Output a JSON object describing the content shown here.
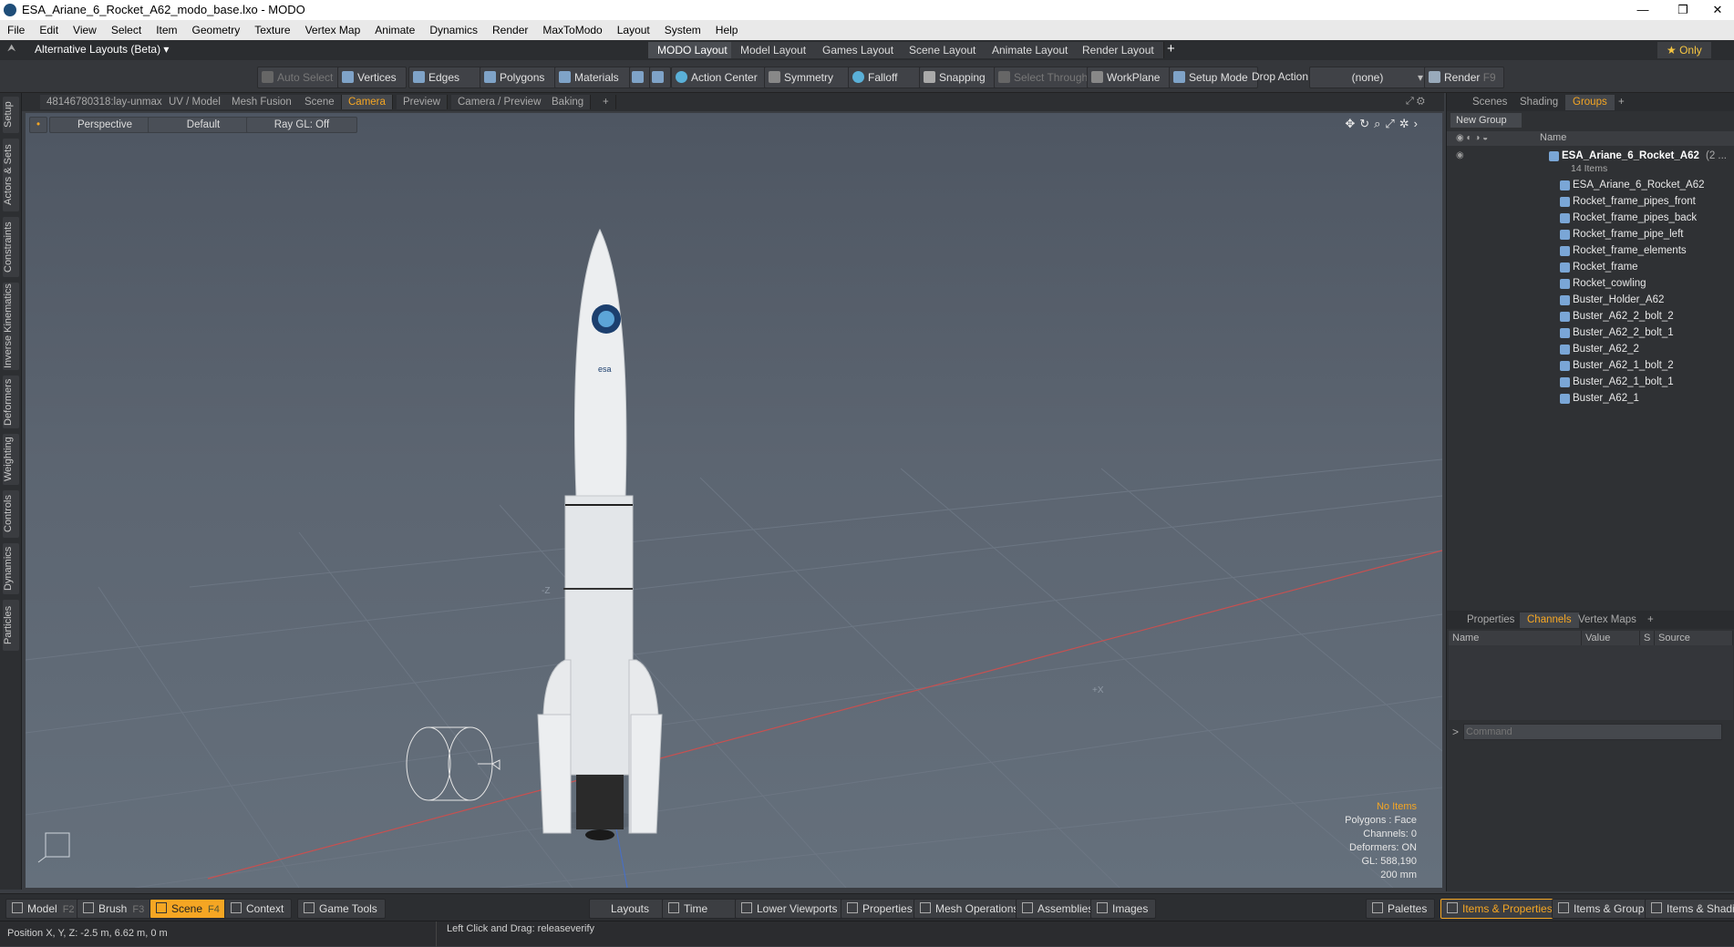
{
  "window": {
    "title": "ESA_Ariane_6_Rocket_A62_modo_base.lxo - MODO",
    "minimize": "—",
    "restore": "❐",
    "close": "✕"
  },
  "menu": [
    "File",
    "Edit",
    "View",
    "Select",
    "Item",
    "Geometry",
    "Texture",
    "Vertex Map",
    "Animate",
    "Dynamics",
    "Render",
    "MaxToModo",
    "Layout",
    "System",
    "Help"
  ],
  "layoutbar": {
    "alt_layouts": "Alternative Layouts (Beta) ▾",
    "tabs": [
      "MODO Layout",
      "Model Layout",
      "Games Layout",
      "Scene Layout",
      "Animate Layout",
      "Render Layout"
    ],
    "add": "+",
    "only": "★ Only"
  },
  "toolbar": {
    "auto_select": "Auto Select",
    "vertices": "Vertices",
    "edges": "Edges",
    "polygons": "Polygons",
    "materials": "Materials",
    "action_center": "Action Center",
    "symmetry": "Symmetry",
    "falloff": "Falloff",
    "snapping": "Snapping",
    "select_through": "Select Through",
    "workplane": "WorkPlane",
    "setup_mode": "Setup Mode",
    "drop_action": "Drop Action",
    "drop_value": "(none)",
    "render": "Render",
    "render_key": "F9"
  },
  "left_tabs": [
    "Setup",
    "Actors & Sets",
    "Constraints",
    "Inverse Kinematics",
    "Deformers",
    "Weighting",
    "Controls",
    "Dynamics",
    "Particles"
  ],
  "viewport_tabs": [
    "48146780318:lay-unmax",
    "UV / Model",
    "Mesh Fusion",
    "Scene",
    "Camera",
    "Preview",
    "Camera / Preview",
    "Baking",
    "+"
  ],
  "viewport": {
    "perspective": "Perspective",
    "default": "Default",
    "raygl": "Ray GL: Off",
    "axis_z": "-Z",
    "axis_x": "+X",
    "info": {
      "items": "No Items",
      "polygons": "Polygons : Face",
      "channels": "Channels: 0",
      "deformers": "Deformers: ON",
      "gl": "GL: 588,190",
      "scale": "200 mm"
    }
  },
  "right_panel": {
    "tabs": [
      "Scenes",
      "Shading",
      "Groups",
      "+"
    ],
    "new_group": "New Group",
    "name_col": "Name",
    "group_name": "ESA_Ariane_6_Rocket_A62",
    "group_suffix": "(2 ...",
    "group_count": "14 Items",
    "items": [
      "ESA_Ariane_6_Rocket_A62",
      "Rocket_frame_pipes_front",
      "Rocket_frame_pipes_back",
      "Rocket_frame_pipe_left",
      "Rocket_frame_elements",
      "Rocket_frame",
      "Rocket_cowling",
      "Buster_Holder_A62",
      "Buster_A62_2_bolt_2",
      "Buster_A62_2_bolt_1",
      "Buster_A62_2",
      "Buster_A62_1_bolt_2",
      "Buster_A62_1_bolt_1",
      "Buster_A62_1"
    ],
    "lower_tabs": [
      "Properties",
      "Channels",
      "Vertex Maps",
      "+"
    ],
    "columns": [
      "Name",
      "Value",
      "S",
      "Source"
    ],
    "command_placeholder": "Command"
  },
  "bottombar": {
    "model": "Model",
    "model_key": "F2",
    "brush": "Brush",
    "brush_key": "F3",
    "scene": "Scene",
    "scene_key": "F4",
    "context": "Context",
    "game_tools": "Game Tools",
    "layouts": "Layouts",
    "time": "Time",
    "lower_viewports": "Lower Viewports",
    "properties": "Properties",
    "mesh_ops": "Mesh Operations",
    "assemblies": "Assemblies",
    "images": "Images",
    "palettes": "Palettes",
    "items_props": "Items & Properties",
    "items_groups": "Items & Groups",
    "items_shading": "Items & Shading"
  },
  "status": {
    "position": "Position X, Y, Z:   -2.5 m, 6.62 m, 0 m",
    "hint": "Left Click and Drag:  releaseverify"
  }
}
